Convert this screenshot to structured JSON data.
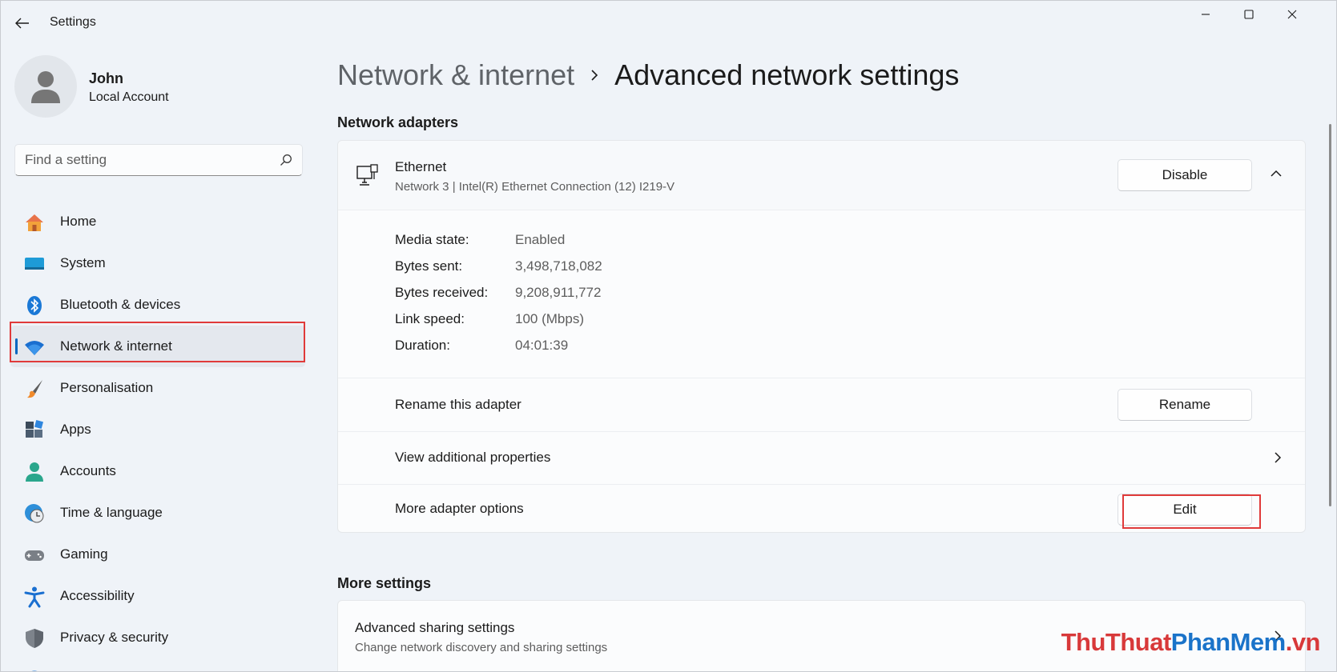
{
  "app": {
    "title": "Settings"
  },
  "profile": {
    "name": "John",
    "account_type": "Local Account"
  },
  "search": {
    "placeholder": "Find a setting"
  },
  "sidebar": {
    "items": [
      {
        "label": "Home",
        "icon": "home-icon",
        "active": false
      },
      {
        "label": "System",
        "icon": "system-icon",
        "active": false
      },
      {
        "label": "Bluetooth & devices",
        "icon": "bluetooth-icon",
        "active": false
      },
      {
        "label": "Network & internet",
        "icon": "wifi-icon",
        "active": true
      },
      {
        "label": "Personalisation",
        "icon": "brush-icon",
        "active": false
      },
      {
        "label": "Apps",
        "icon": "apps-icon",
        "active": false
      },
      {
        "label": "Accounts",
        "icon": "accounts-icon",
        "active": false
      },
      {
        "label": "Time & language",
        "icon": "time-language-icon",
        "active": false
      },
      {
        "label": "Gaming",
        "icon": "gamepad-icon",
        "active": false
      },
      {
        "label": "Accessibility",
        "icon": "accessibility-icon",
        "active": false
      },
      {
        "label": "Privacy & security",
        "icon": "shield-icon",
        "active": false
      }
    ]
  },
  "breadcrumb": {
    "parent": "Network & internet",
    "current": "Advanced network settings"
  },
  "network_adapters": {
    "section_title": "Network adapters",
    "adapter": {
      "name": "Ethernet",
      "description": "Network 3 | Intel(R) Ethernet Connection (12) I219-V",
      "disable_label": "Disable",
      "details": [
        {
          "label": "Media state:",
          "value": "Enabled"
        },
        {
          "label": "Bytes sent:",
          "value": "3,498,718,082"
        },
        {
          "label": "Bytes received:",
          "value": "9,208,911,772"
        },
        {
          "label": "Link speed:",
          "value": "100 (Mbps)"
        },
        {
          "label": "Duration:",
          "value": "04:01:39"
        }
      ],
      "rename_row_label": "Rename this adapter",
      "rename_button": "Rename",
      "view_props_label": "View additional properties",
      "more_options_label": "More adapter options",
      "edit_button": "Edit"
    }
  },
  "more_settings": {
    "section_title": "More settings",
    "advanced_sharing": {
      "title": "Advanced sharing settings",
      "subtitle": "Change network discovery and sharing settings"
    }
  },
  "watermark": {
    "part1": "ThuThuat",
    "part2": "PhanMem",
    "part3": ".vn"
  },
  "colors": {
    "accent": "#0067c0",
    "highlight": "#e03a3a",
    "background": "#eff3f8"
  }
}
